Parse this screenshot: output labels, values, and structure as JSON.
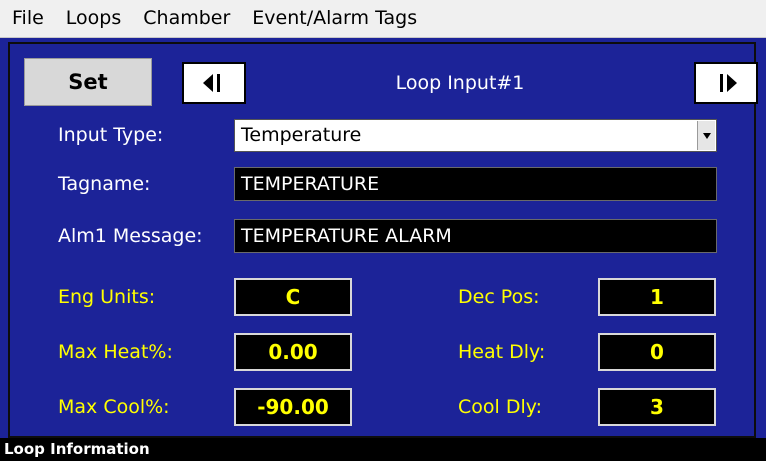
{
  "menu": {
    "items": [
      {
        "label": "File"
      },
      {
        "label": "Loops"
      },
      {
        "label": "Chamber"
      },
      {
        "label": "Event/Alarm Tags"
      }
    ]
  },
  "toolbar": {
    "set_label": "Set",
    "prev_icon": "arrow-left-icon",
    "next_icon": "arrow-right-icon",
    "loop_title": "Loop Input#1"
  },
  "form": {
    "input_type": {
      "label": "Input Type:",
      "value": "Temperature"
    },
    "tagname": {
      "label": "Tagname:",
      "value": "TEMPERATURE"
    },
    "alm1_message": {
      "label": "Alm1 Message:",
      "value": "TEMPERATURE ALARM"
    },
    "eng_units": {
      "label": "Eng Units:",
      "value": "C"
    },
    "max_heat": {
      "label": "Max Heat%:",
      "value": "0.00"
    },
    "max_cool": {
      "label": "Max Cool%:",
      "value": "-90.00"
    },
    "dec_pos": {
      "label": "Dec Pos:",
      "value": "1"
    },
    "heat_dly": {
      "label": "Heat Dly:",
      "value": "0"
    },
    "cool_dly": {
      "label": "Cool Dly:",
      "value": "3"
    }
  },
  "status": {
    "text": "Loop Information"
  },
  "colors": {
    "background": "#1c2398",
    "label_white": "#ffffff",
    "label_yellow": "#ffff00",
    "field_background": "#000000"
  }
}
